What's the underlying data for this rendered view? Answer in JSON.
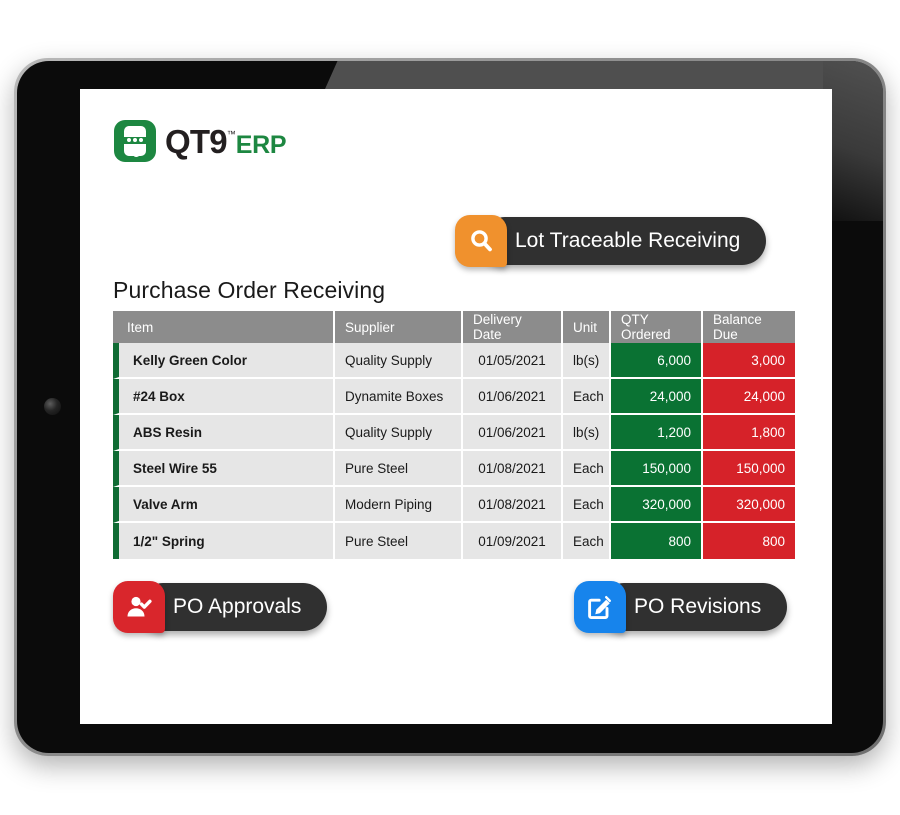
{
  "brand": {
    "name_primary": "QT9",
    "trademark": "™",
    "name_secondary": "ERP",
    "logo_icon": "qt9-logo-icon",
    "primary_color": "#1d8741"
  },
  "page": {
    "title": "Purchase Order Receiving"
  },
  "badges": [
    {
      "id": "lot-traceable-receiving",
      "label": "Lot Traceable Receiving",
      "icon": "search-icon",
      "color": "#f0912d"
    },
    {
      "id": "po-approvals",
      "label": "PO Approvals",
      "icon": "user-check-icon",
      "color": "#d9262c"
    },
    {
      "id": "po-revisions",
      "label": "PO Revisions",
      "icon": "edit-square-icon",
      "color": "#1784ec"
    }
  ],
  "table": {
    "columns": [
      "Item",
      "Supplier",
      "Delivery Date",
      "Unit",
      "QTY Ordered",
      "Balance Due"
    ],
    "header_bg": "#8c8c8c",
    "qty_bg": "#0a7233",
    "balance_bg": "#d62229",
    "row_accent": "#0f6b33",
    "rows": [
      {
        "item": "Kelly Green Color",
        "supplier": "Quality Supply",
        "delivery_date": "01/05/2021",
        "unit": "lb(s)",
        "qty_ordered": "6,000",
        "balance_due": "3,000"
      },
      {
        "item": "#24 Box",
        "supplier": "Dynamite Boxes",
        "delivery_date": "01/06/2021",
        "unit": "Each",
        "qty_ordered": "24,000",
        "balance_due": "24,000"
      },
      {
        "item": "ABS Resin",
        "supplier": "Quality Supply",
        "delivery_date": "01/06/2021",
        "unit": "lb(s)",
        "qty_ordered": "1,200",
        "balance_due": "1,800"
      },
      {
        "item": "Steel Wire 55",
        "supplier": "Pure Steel",
        "delivery_date": "01/08/2021",
        "unit": "Each",
        "qty_ordered": "150,000",
        "balance_due": "150,000"
      },
      {
        "item": "Valve Arm",
        "supplier": "Modern Piping",
        "delivery_date": "01/08/2021",
        "unit": "Each",
        "qty_ordered": "320,000",
        "balance_due": "320,000"
      },
      {
        "item": "1/2\" Spring",
        "supplier": "Pure Steel",
        "delivery_date": "01/09/2021",
        "unit": "Each",
        "qty_ordered": "800",
        "balance_due": "800"
      }
    ]
  }
}
